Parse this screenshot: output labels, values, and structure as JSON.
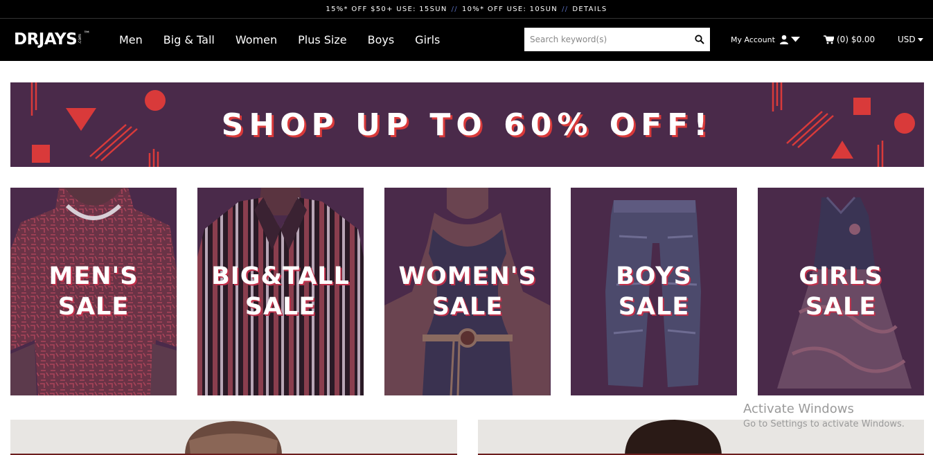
{
  "promo_bar": {
    "offer1": "15%* OFF $50+ USE: 15SUN",
    "separator": "//",
    "offer2": "10%* OFF USE: 10SUN",
    "details": "DETAILS"
  },
  "header": {
    "logo_word": "DRJAYS",
    "logo_dotcom": ".com",
    "logo_tm": "™",
    "nav": [
      "Men",
      "Big & Tall",
      "Women",
      "Plus Size",
      "Boys",
      "Girls"
    ],
    "search_placeholder": "Search keyword(s)",
    "account_label": "My Account",
    "cart_label": "(0) $0.00",
    "currency": "USD"
  },
  "hero": {
    "text": "SHOP UP TO 60% OFF!"
  },
  "tiles": [
    {
      "line1": "MEN'S",
      "line2": "SALE"
    },
    {
      "line1": "BIG&TALL",
      "line2": "SALE"
    },
    {
      "line1": "WOMEN'S",
      "line2": "SALE"
    },
    {
      "line1": "BOYS",
      "line2": "SALE"
    },
    {
      "line1": "GIRLS",
      "line2": "SALE"
    }
  ],
  "watermark": {
    "title": "Activate Windows",
    "subtitle": "Go to Settings to activate Windows."
  },
  "colors": {
    "tile_bg": "#4a2a4a",
    "accent_red": "#d93a3a",
    "header_bg": "#000000"
  }
}
